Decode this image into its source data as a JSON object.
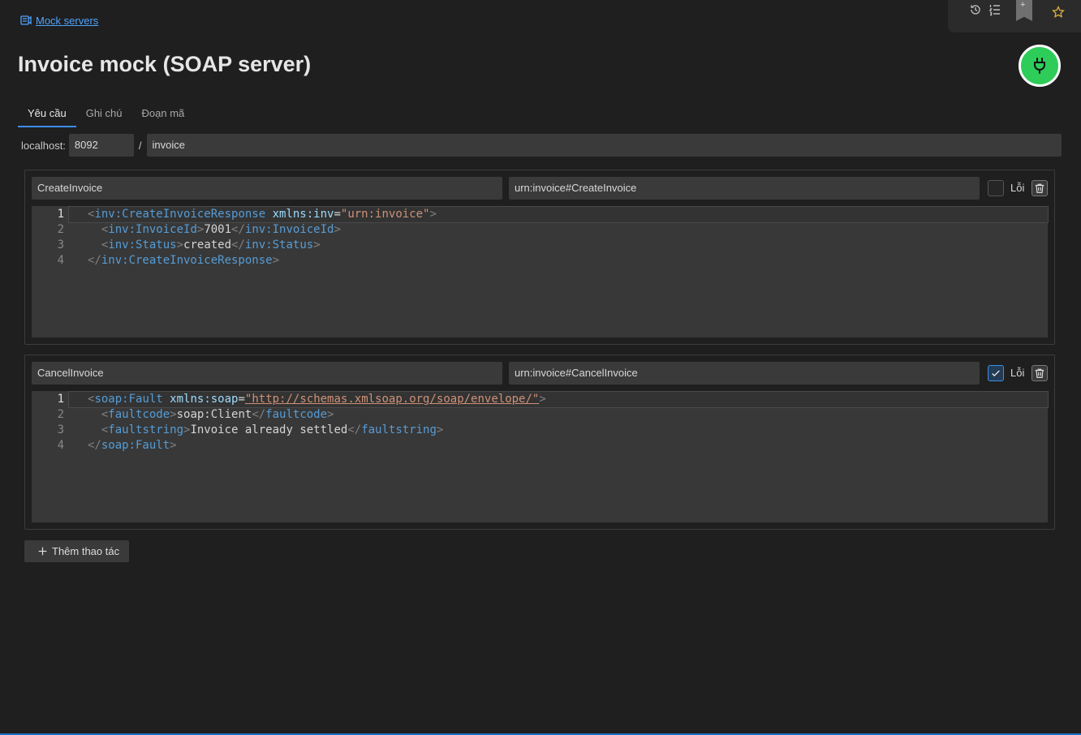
{
  "breadcrumb": {
    "label": "Mock servers",
    "icon": "server-link-icon"
  },
  "toolbar": {
    "icons": [
      "history-icon",
      "list-icon",
      "bookmark-icon",
      "star-icon"
    ],
    "bookmark_symbol": "+"
  },
  "page": {
    "title": "Invoice mock (SOAP server)"
  },
  "server_toggle": {
    "icon": "power-plug-icon",
    "state": "running",
    "color": "#2ecc59"
  },
  "tabs": [
    {
      "label": "Yêu cầu",
      "active": true
    },
    {
      "label": "Ghi chú",
      "active": false
    },
    {
      "label": "Đoạn mã",
      "active": false
    }
  ],
  "endpoint": {
    "host_label": "localhost:",
    "port": "8092",
    "separator": "/",
    "path": "invoice"
  },
  "operations": [
    {
      "name": "CreateInvoice",
      "action": "urn:invoice#CreateInvoice",
      "fault_checked": false,
      "fault_label": "Lỗi",
      "lines": [
        {
          "no": "1"
        },
        {
          "no": "2"
        },
        {
          "no": "3"
        },
        {
          "no": "4"
        }
      ],
      "body": {
        "l1_tag": "inv:CreateInvoiceResponse",
        "l1_attr": "xmlns:inv",
        "l1_val": "\"urn:invoice\"",
        "l2_tag": "inv:InvoiceId",
        "l2_text": "7001",
        "l3_tag": "inv:Status",
        "l3_text": "created",
        "l4_tag": "inv:CreateInvoiceResponse"
      }
    },
    {
      "name": "CancelInvoice",
      "action": "urn:invoice#CancelInvoice",
      "fault_checked": true,
      "fault_label": "Lỗi",
      "lines": [
        {
          "no": "1"
        },
        {
          "no": "2"
        },
        {
          "no": "3"
        },
        {
          "no": "4"
        }
      ],
      "body": {
        "l1_tag": "soap:Fault",
        "l1_attr": "xmlns:soap",
        "l1_val": "\"http://schemas.xmlsoap.org/soap/envelope/\"",
        "l2_tag": "faultcode",
        "l2_text": "soap:Client",
        "l3_tag": "faultstring",
        "l3_text": "Invoice already settled",
        "l4_tag": "soap:Fault"
      }
    }
  ],
  "add_operation": {
    "label": "Thêm thao tác",
    "icon": "plus-icon"
  },
  "colors": {
    "accent": "#3b8eea",
    "link": "#4fa3ff",
    "background": "#1f1f1f"
  }
}
